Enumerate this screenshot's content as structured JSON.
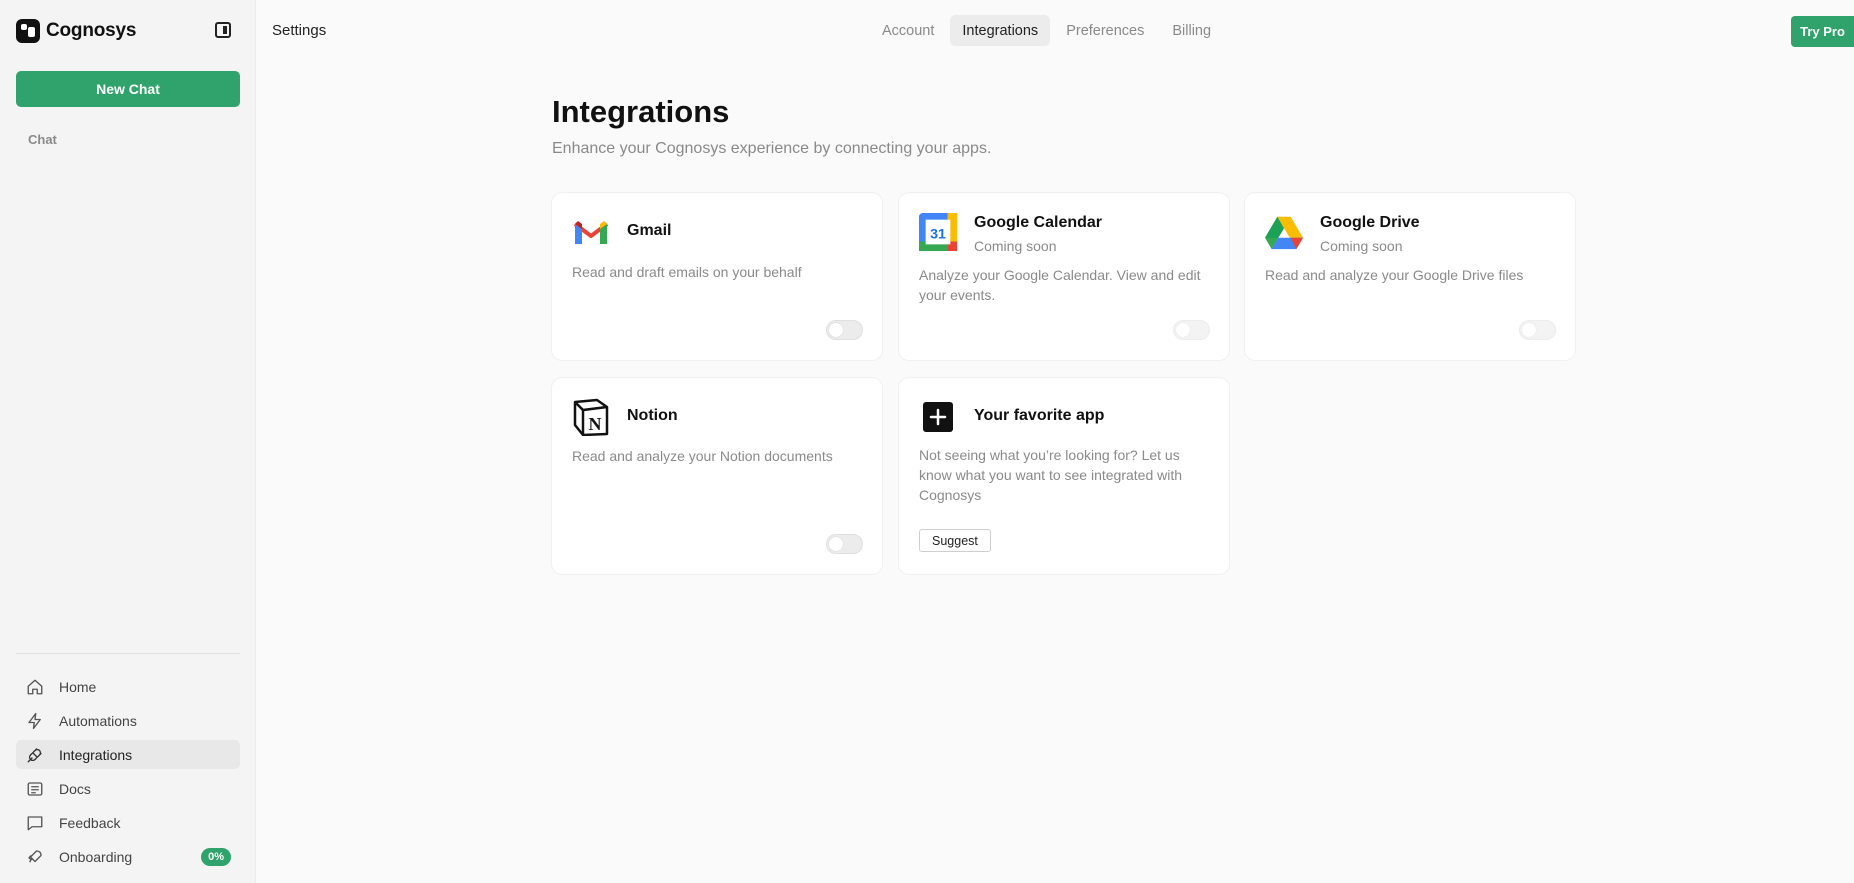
{
  "brand": {
    "name": "Cognosys"
  },
  "sidebar": {
    "new_chat_label": "New Chat",
    "section_label": "Chat",
    "nav": [
      {
        "label": "Home",
        "icon": "home-icon"
      },
      {
        "label": "Automations",
        "icon": "bolt-icon"
      },
      {
        "label": "Integrations",
        "icon": "plug-icon",
        "active": true
      },
      {
        "label": "Docs",
        "icon": "docs-icon"
      },
      {
        "label": "Feedback",
        "icon": "chat-bubble-icon"
      },
      {
        "label": "Onboarding",
        "icon": "rocket-icon",
        "badge": "0%"
      }
    ]
  },
  "header": {
    "page_label": "Settings",
    "tabs": [
      {
        "label": "Account"
      },
      {
        "label": "Integrations",
        "active": true
      },
      {
        "label": "Preferences"
      },
      {
        "label": "Billing"
      }
    ],
    "try_pro_label": "Try Pro"
  },
  "main": {
    "title": "Integrations",
    "subtitle": "Enhance your Cognosys experience by connecting your apps.",
    "cards": [
      {
        "name": "Gmail",
        "status": "",
        "description": "Read and draft emails on your behalf",
        "toggle_on": false,
        "icon": "gmail-icon"
      },
      {
        "name": "Google Calendar",
        "status": "Coming soon",
        "description": "Analyze your Google Calendar. View and edit your events.",
        "toggle_on": false,
        "icon": "google-calendar-icon",
        "calendar_day": "31"
      },
      {
        "name": "Google Drive",
        "status": "Coming soon",
        "description": "Read and analyze your Google Drive files",
        "toggle_on": false,
        "icon": "google-drive-icon"
      },
      {
        "name": "Notion",
        "status": "",
        "description": "Read and analyze your Notion documents",
        "toggle_on": false,
        "icon": "notion-icon",
        "logo_letter": "N"
      },
      {
        "name": "Your favorite app",
        "status": "",
        "description": "Not seeing what you’re looking for? Let us know what you want to see integrated with Cognosys",
        "button_label": "Suggest",
        "icon": "plus-icon"
      }
    ]
  },
  "colors": {
    "accent": "#2fa36b",
    "muted_text": "#8a8a8a",
    "background": "#fafafa"
  }
}
